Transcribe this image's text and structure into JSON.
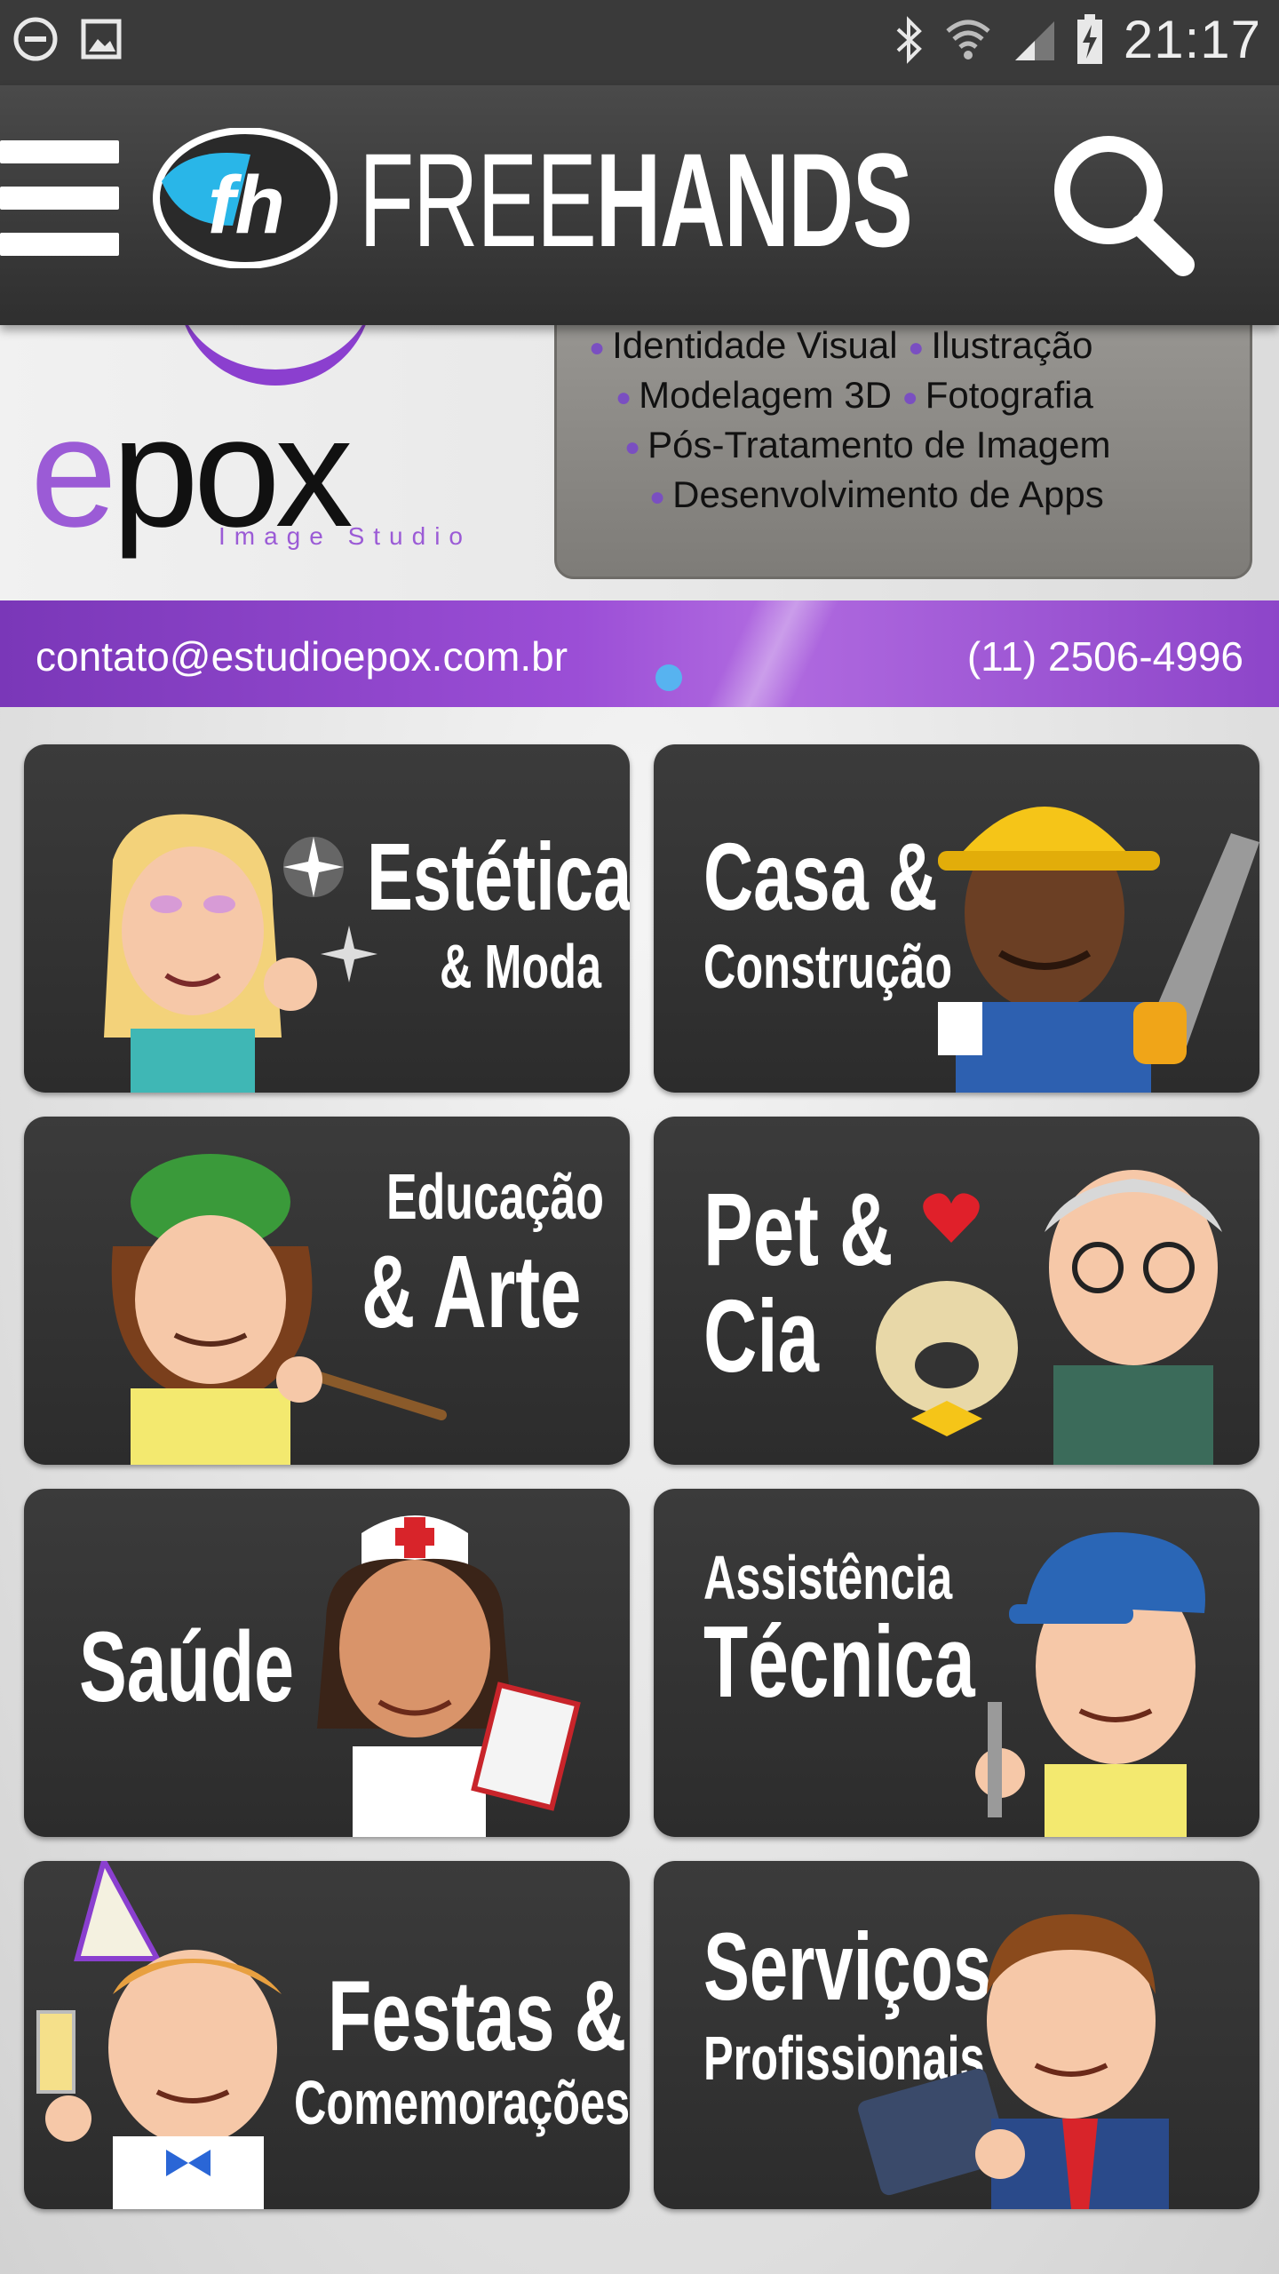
{
  "status_bar": {
    "time": "21:17",
    "icons": [
      "do-not-disturb-icon",
      "image-notification-icon",
      "bluetooth-icon",
      "wifi-icon",
      "signal-icon",
      "battery-charging-icon"
    ]
  },
  "app_bar": {
    "brand_part1": "FREE",
    "brand_part2": "HANDS",
    "menu_icon": "hamburger-menu-icon",
    "search_icon": "search-icon"
  },
  "banner": {
    "brand": "epox",
    "brand_first_letter": "e",
    "brand_rest": "pox",
    "subtitle": "Image Studio",
    "services": [
      "Identidade Visual",
      "Ilustração",
      "Modelagem 3D",
      "Fotografia",
      "Pós-Tratamento de Imagem",
      "Desenvolvimento de Apps"
    ],
    "email": "contato@estudioepox.com.br",
    "phone": "(11) 2506-4996"
  },
  "categories": [
    {
      "line1": "Estética",
      "line2": "& Moda"
    },
    {
      "line1": "Casa &",
      "line2": "Construção"
    },
    {
      "line1": "Educação",
      "line2": "& Arte"
    },
    {
      "line1": "Pet &",
      "line2": "Cia"
    },
    {
      "line1": "Saúde",
      "line2": ""
    },
    {
      "line1": "Assistência",
      "line2": "Técnica"
    },
    {
      "line1": "Festas &",
      "line2": "Comemorações"
    },
    {
      "line1": "Serviços",
      "line2": "Profissionais"
    }
  ]
}
